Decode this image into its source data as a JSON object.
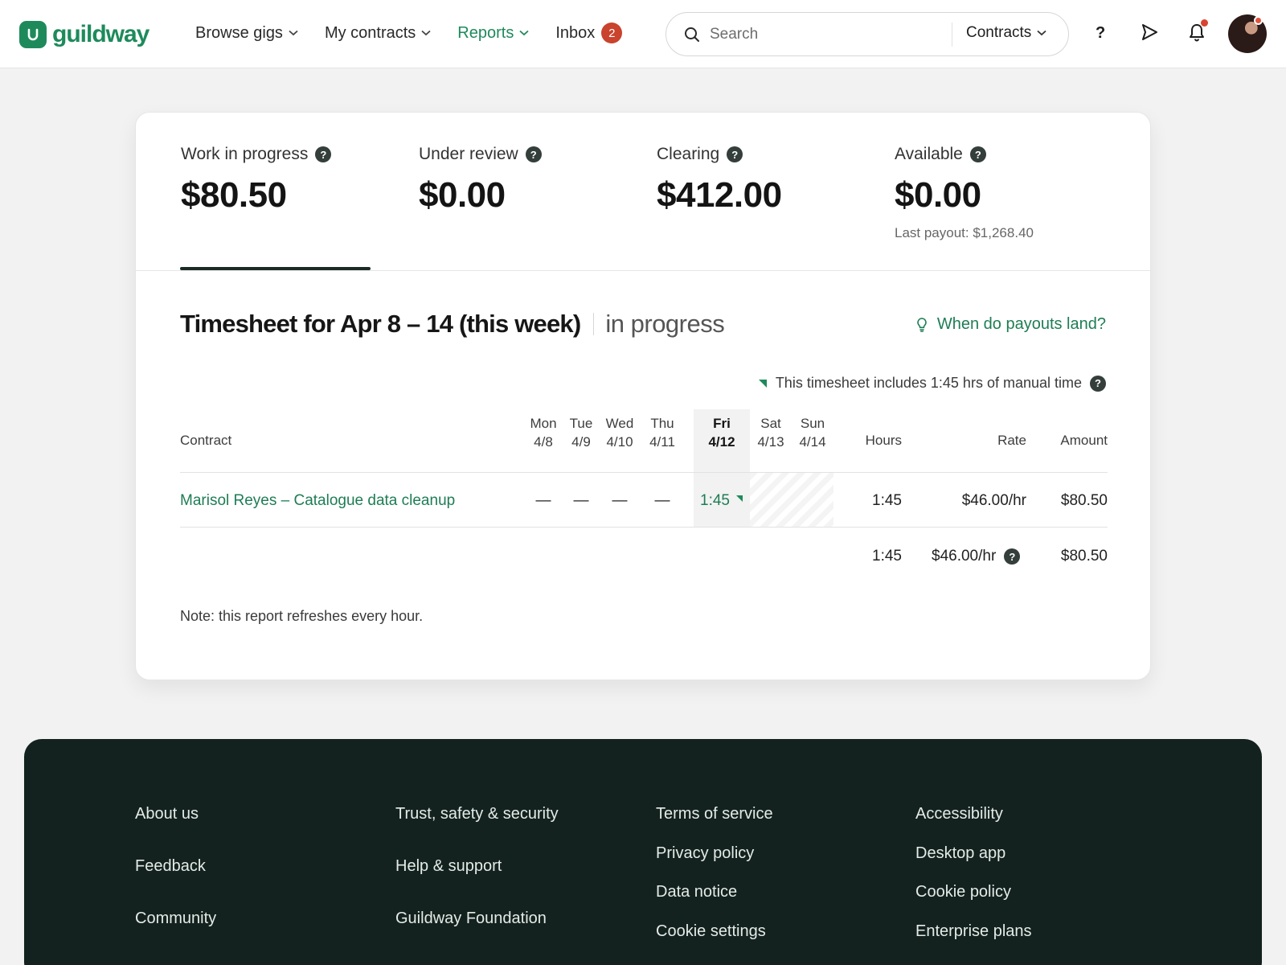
{
  "brand": {
    "name": "guildway",
    "mark": "U"
  },
  "nav": {
    "browse": "Browse gigs",
    "contracts": "My contracts",
    "reports": "Reports",
    "inbox": "Inbox",
    "inbox_count": "2"
  },
  "search": {
    "placeholder": "Search",
    "scope": "Contracts"
  },
  "header_icons": {
    "help": "?",
    "send": "send-icon",
    "bell": "bell-icon"
  },
  "stats": [
    {
      "label": "Work in progress",
      "value": "$80.50"
    },
    {
      "label": "Under review",
      "value": "$0.00"
    },
    {
      "label": "Clearing",
      "value": "$412.00"
    },
    {
      "label": "Available",
      "value": "$0.00",
      "sub": "Last payout: $1,268.40"
    }
  ],
  "timesheet": {
    "title": "Timesheet for Apr 8 – 14 (this week)",
    "status": "in progress",
    "payout_link": "When do payouts land?",
    "manual_note": "This timesheet includes 1:45 hrs of manual time",
    "columns": {
      "contract": "Contract",
      "hours": "Hours",
      "rate": "Rate",
      "amount": "Amount",
      "days": [
        {
          "day": "Mon",
          "date": "4/8"
        },
        {
          "day": "Tue",
          "date": "4/9"
        },
        {
          "day": "Wed",
          "date": "4/10"
        },
        {
          "day": "Thu",
          "date": "4/11"
        },
        {
          "day": "Fri",
          "date": "4/12"
        },
        {
          "day": "Sat",
          "date": "4/13"
        },
        {
          "day": "Sun",
          "date": "4/14"
        }
      ]
    },
    "rows": [
      {
        "contract": "Marisol Reyes – Catalogue data cleanup",
        "days": [
          "—",
          "—",
          "—",
          "—",
          "1:45",
          "",
          ""
        ],
        "hours": "1:45",
        "rate": "$46.00/hr",
        "amount": "$80.50"
      }
    ],
    "totals": {
      "hours": "1:45",
      "rate": "$46.00/hr",
      "amount": "$80.50"
    },
    "note": "Note: this report refreshes every hour."
  },
  "footer": {
    "col1": [
      "About us",
      "Feedback",
      "Community"
    ],
    "col2": [
      "Trust, safety & security",
      "Help & support",
      "Guildway Foundation"
    ],
    "col3": [
      "Terms of service",
      "Privacy policy",
      "Data notice",
      "Cookie settings"
    ],
    "col4": [
      "Accessibility",
      "Desktop app",
      "Cookie policy",
      "Enterprise plans"
    ]
  },
  "colors": {
    "brand": "#1e8a5b",
    "footer_bg": "#13221e",
    "badge": "#c9432d"
  }
}
